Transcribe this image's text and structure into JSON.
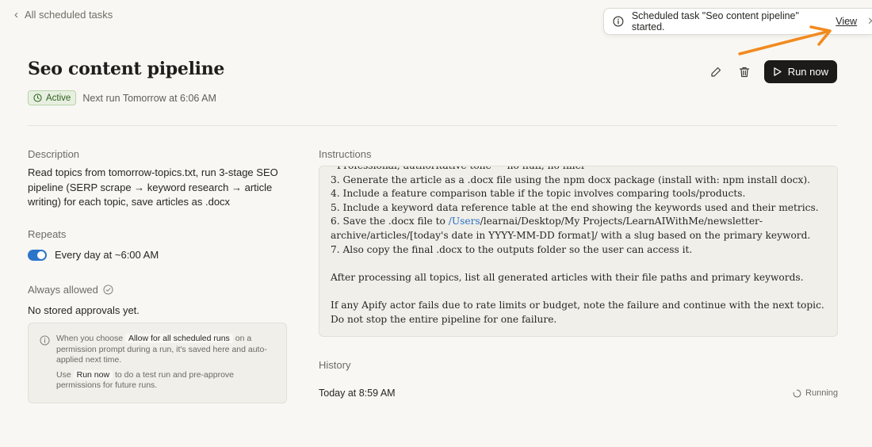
{
  "nav": {
    "back_label": "All scheduled tasks"
  },
  "task": {
    "title": "Seo content pipeline",
    "status": "Active",
    "next_run": "Next run Tomorrow at 6:06 AM"
  },
  "actions": {
    "edit_icon": "pencil-icon",
    "delete_icon": "trash-icon",
    "run_label": "Run now"
  },
  "description": {
    "label": "Description",
    "text": "Read topics from tomorrow-topics.txt, run 3-stage SEO pipeline (SERP scrape → keyword research → article writing) for each topic, save articles as .docx"
  },
  "repeats": {
    "label": "Repeats",
    "value": "Every day at ~6:00 AM",
    "enabled": true
  },
  "always_allowed": {
    "label": "Always allowed",
    "empty_text": "No stored approvals yet.",
    "info_p1_pre": "When you choose",
    "info_p1_kbd": "Allow for all scheduled runs",
    "info_p1_post": "on a permission prompt during a run, it's saved here and auto-applied next time.",
    "info_p2_pre": "Use",
    "info_p2_kbd": "Run now",
    "info_p2_post": "to do a test run and pre-approve permissions for future runs."
  },
  "instructions": {
    "label": "Instructions",
    "line_0": "- Professional, authoritative tone — no fluff, no filler",
    "line_3": "3. Generate the article as a .docx file using the npm docx package (install with: npm install docx).",
    "line_4": "4. Include a feature comparison table if the topic involves comparing tools/products.",
    "line_5": "5. Include a keyword data reference table at the end showing the keywords used and their metrics.",
    "line_6_pre": "6. Save the .docx file to ",
    "line_6_link": "/Users",
    "line_6_post": "/learnai/Desktop/My Projects/LearnAIWithMe/newsletter-archive/articles/[today's date in YYYY-MM-DD format]/ with a slug based on the primary keyword.",
    "line_7": "7. Also copy the final .docx to the outputs folder so the user can access it.",
    "para_2": "After processing all topics, list all generated articles with their file paths and primary keywords.",
    "para_3": "If any Apify actor fails due to rate limits or budget, note the failure and continue with the next topic. Do not stop the entire pipeline for one failure."
  },
  "history": {
    "label": "History",
    "entries": [
      {
        "time": "Today at 8:59 AM",
        "status": "Running"
      }
    ]
  },
  "toast": {
    "message": "Scheduled task \"Seo content pipeline\" started.",
    "action": "View"
  },
  "colors": {
    "background": "#f8f7f3",
    "primary_button": "#1c1b19",
    "toggle_on": "#2b74c9",
    "active_badge": "#e7f0e0",
    "link": "#2b6cc4",
    "annotation_arrow": "#f28a1e"
  }
}
